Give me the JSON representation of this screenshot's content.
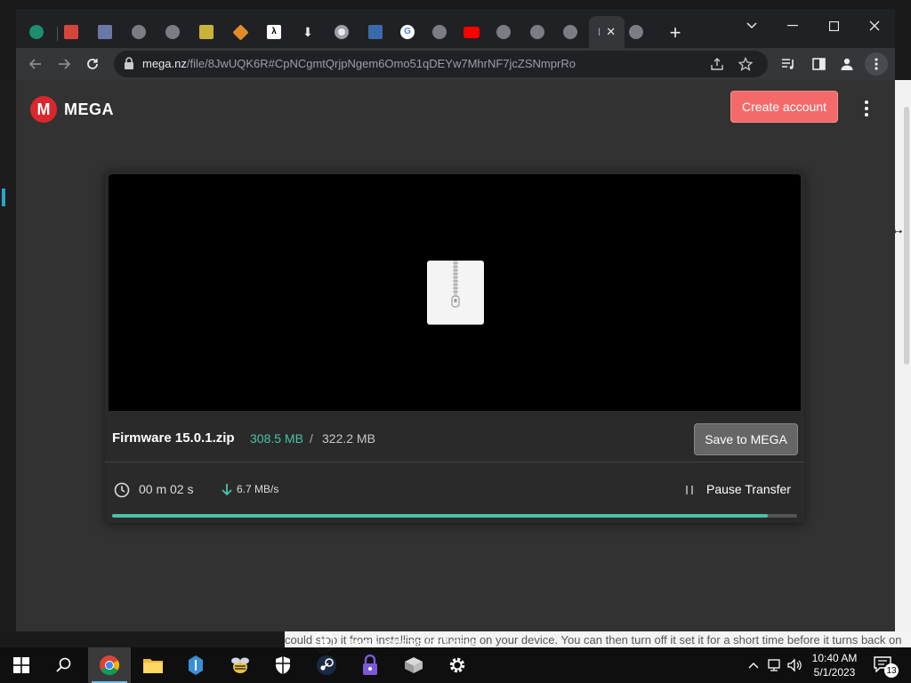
{
  "browser": {
    "url_host": "mega.nz",
    "url_path": "/file/8JwUQK6R#CpNCgmtQrjpNgem6Omo51qDEYw7MhrNF7jcZSNmprRo",
    "active_tab_title": "I",
    "new_tab": "+"
  },
  "mega": {
    "logo_letter": "M",
    "logo_word": "MEGA",
    "create_account": "Create account",
    "file_name": "Firmware 15.0.1.zip",
    "size_done": "308.5 MB",
    "size_sep": "/",
    "size_total": "322.2 MB",
    "save_to_mega": "Save to MEGA",
    "time_left": "00 m  02 s",
    "speed": "6.7 MB/s",
    "pause_transfer": "Pause Transfer",
    "progress_percent": 95.7,
    "accent": "#4ac3a8"
  },
  "background": {
    "behind_text": "could stop it from installing or running on your device. You can then turn off it set it for a short time before it turns back on"
  },
  "notification": {
    "pause_updates": "Pause updates for 7 days"
  },
  "taskbar": {
    "time": "10:40 AM",
    "date": "5/1/2023",
    "notification_count": "13"
  }
}
